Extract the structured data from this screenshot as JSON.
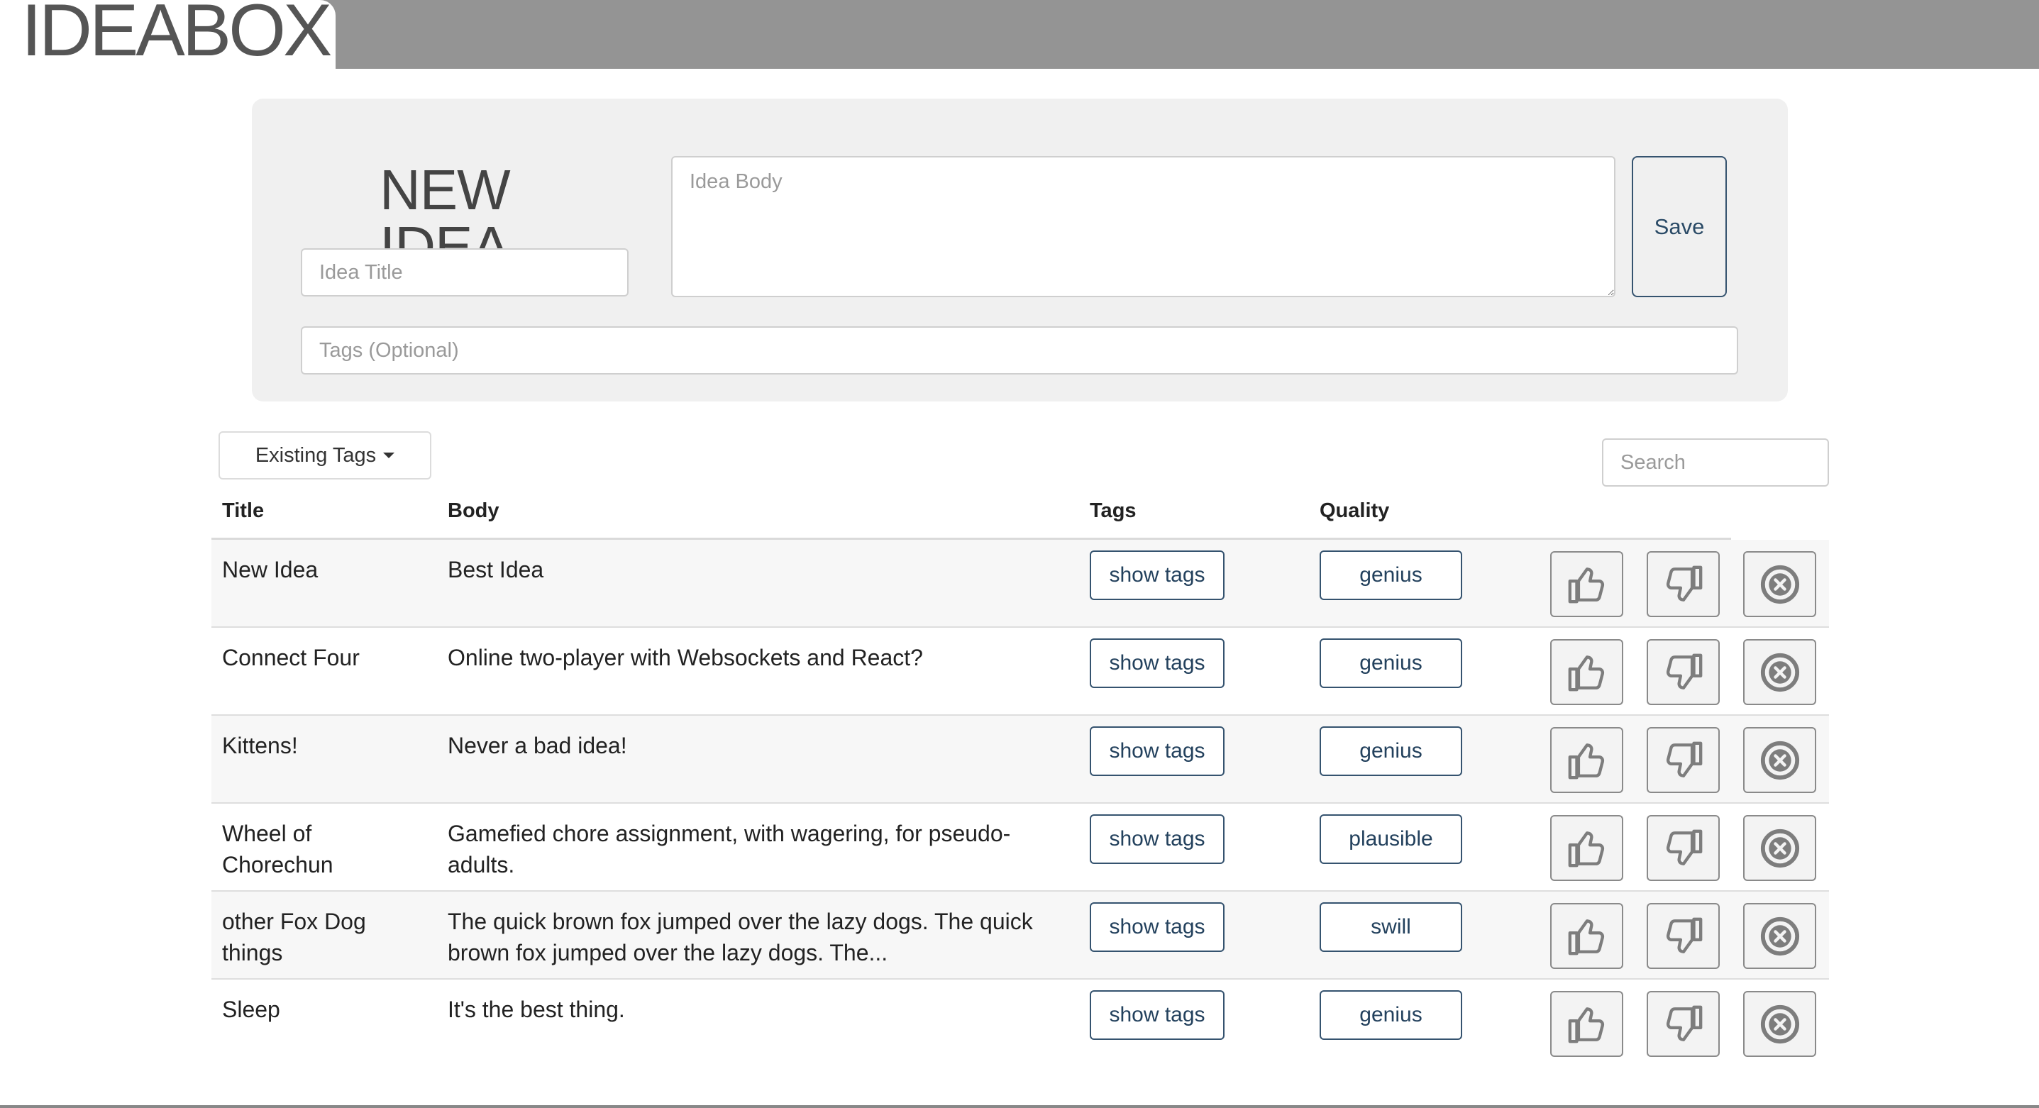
{
  "header": {
    "logo": "IDEABOX"
  },
  "new_idea": {
    "heading": "NEW IDEA",
    "title_placeholder": "Idea Title",
    "body_placeholder": "Idea Body",
    "tags_placeholder": "Tags (Optional)",
    "save_label": "Save"
  },
  "toolbar": {
    "existing_tags_label": "Existing Tags",
    "search_placeholder": "Search"
  },
  "table": {
    "columns": [
      "Title",
      "Body",
      "Tags",
      "Quality"
    ],
    "rows": [
      {
        "title": "New Idea",
        "body": "Best Idea",
        "tags_button": "show tags",
        "quality": "genius"
      },
      {
        "title": "Connect Four",
        "body": "Online two-player with Websockets and React?",
        "tags_button": "show tags",
        "quality": "genius"
      },
      {
        "title": "Kittens!",
        "body": "Never a bad idea!",
        "tags_button": "show tags",
        "quality": "genius"
      },
      {
        "title": "Wheel of Chorechun",
        "body": "Gamefied chore assignment, with wagering, for pseudo-adults.",
        "tags_button": "show tags",
        "quality": "plausible"
      },
      {
        "title": "other Fox Dog things",
        "body": "The quick brown fox jumped over the lazy dogs. The quick brown fox jumped over the lazy dogs. The...",
        "tags_button": "show tags",
        "quality": "swill"
      },
      {
        "title": "Sleep",
        "body": "It's the best thing.",
        "tags_button": "show tags",
        "quality": "genius"
      }
    ]
  },
  "icons": {
    "upvote": "thumbs-up-icon",
    "downvote": "thumbs-down-icon",
    "delete": "x-circle-icon"
  },
  "colors": {
    "header_bar": "#949494",
    "panel_bg": "#f0f0f0",
    "button_border": "#35536f",
    "icon_gray": "#8a8a8a"
  }
}
